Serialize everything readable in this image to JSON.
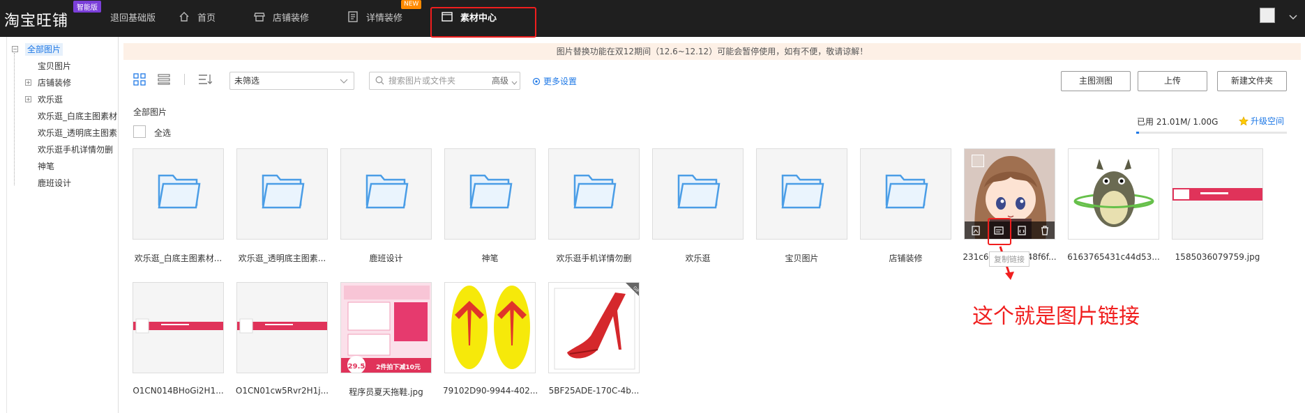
{
  "topbar": {
    "logo": "淘宝旺铺",
    "edition_badge": "智能版",
    "back_basic": "退回基础版",
    "nav": [
      {
        "label": "首页",
        "icon": "home-icon"
      },
      {
        "label": "店铺装修",
        "icon": "store-icon"
      },
      {
        "label": "详情装修",
        "icon": "document-icon",
        "badge": "NEW"
      },
      {
        "label": "素材中心",
        "icon": "material-icon",
        "active": true
      }
    ]
  },
  "sidebar": {
    "items": [
      {
        "label": "全部图片",
        "selected": true
      },
      {
        "label": "宝贝图片"
      },
      {
        "label": "店铺装修"
      },
      {
        "label": "欢乐逛"
      },
      {
        "label": "欢乐逛_白底主图素材"
      },
      {
        "label": "欢乐逛_透明底主图素"
      },
      {
        "label": "欢乐逛手机详情勿删"
      },
      {
        "label": "神笔"
      },
      {
        "label": "鹿班设计"
      }
    ]
  },
  "notice": "图片替换功能在双12期间（12.6~12.12）可能会暂停使用，如有不便，敬请谅解！",
  "toolbar": {
    "filter_value": "未筛选",
    "search_placeholder": "搜索图片或文件夹",
    "advanced_label": "高级",
    "more_settings": "更多设置",
    "btn_main_test": "主图测图",
    "btn_upload": "上传",
    "btn_new_folder": "新建文件夹"
  },
  "content": {
    "breadcrumb": "全部图片",
    "select_all": "全选",
    "usage": "已用 21.01M/ 1.00G",
    "usage_fraction": 0.02,
    "upgrade": "升级空间"
  },
  "row1": [
    {
      "name": "欢乐逛_白底主图素材...",
      "kind": "folder"
    },
    {
      "name": "欢乐逛_透明底主图素...",
      "kind": "folder"
    },
    {
      "name": "鹿班设计",
      "kind": "folder"
    },
    {
      "name": "神笔",
      "kind": "folder"
    },
    {
      "name": "欢乐逛手机详情勿删",
      "kind": "folder"
    },
    {
      "name": "欢乐逛",
      "kind": "folder"
    },
    {
      "name": "宝贝图片",
      "kind": "folder"
    },
    {
      "name": "店铺装修",
      "kind": "folder"
    },
    {
      "name": "231c6bc...843c48f6f...",
      "kind": "image"
    },
    {
      "name": "6163765431c44d53...",
      "kind": "image"
    },
    {
      "name": "1585036079759.jpg",
      "kind": "image"
    }
  ],
  "row2": [
    {
      "name": "O1CN014BHoGi2H1...",
      "kind": "image"
    },
    {
      "name": "O1CN01cw5Rvr2H1j...",
      "kind": "image"
    },
    {
      "name": "程序员夏天拖鞋.jpg",
      "kind": "image"
    },
    {
      "name": "79102D90-9944-402...",
      "kind": "image"
    },
    {
      "name": "5BF25ADE-170C-4b...",
      "kind": "image"
    }
  ],
  "tooltip": "复制链接",
  "annotation": "这个就是图片链接",
  "thumb_text": {
    "promo1": "29.5",
    "promo2": "2件拍下减10元",
    "gif_badge": "GIF"
  }
}
